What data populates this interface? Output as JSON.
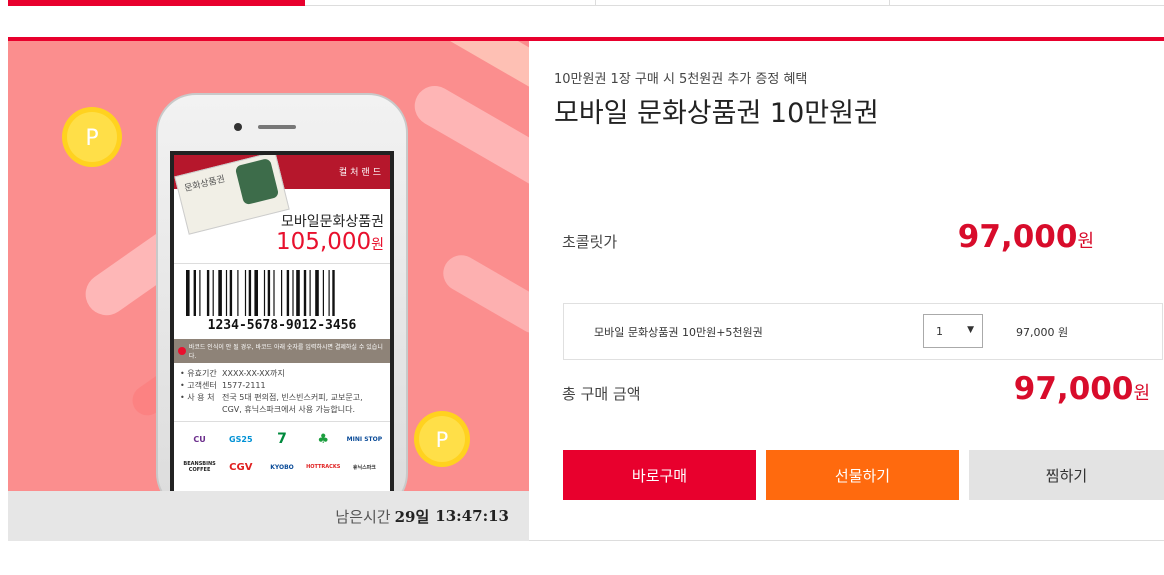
{
  "colors": {
    "accent": "#e8002d",
    "gift": "#ff6a0e",
    "wish": "#e3e3e3",
    "visual_bg": "#fb8e8e",
    "coin": "#ffd21f"
  },
  "tabs": [
    {
      "label": ""
    },
    {
      "label": ""
    },
    {
      "label": ""
    },
    {
      "label": ""
    }
  ],
  "product": {
    "subtitle": "10만원권 1장 구매 시 5천원권 추가 증정 혜택",
    "title": "모바일 문화상품권 10만원권",
    "price_label": "초콜릿가",
    "price": "97,000",
    "currency": "원"
  },
  "visual": {
    "coin_symbol": "P",
    "ticket_brand": "컬처랜드",
    "voucher_text": "문화상품권",
    "ticket_name": "모바일문화상품권",
    "ticket_price": "105,000",
    "ticket_price_unit": "원",
    "barcode_number": "1234-5678-9012-3456",
    "notice": "바코드 인식이 안 될 경우, 바코드 아래 숫자를 입력하시면 결제하실 수 있습니다.",
    "info": [
      {
        "key": "• 유효기간",
        "value": "XXXX-XX-XX까지"
      },
      {
        "key": "• 고객센터",
        "value": "1577-2111"
      },
      {
        "key": "• 사 용 처",
        "value": "전국 5대 편의점, 빈스빈스커피, 교보문고, CGV, 휴닉스파크에서 사용 가능합니다."
      }
    ],
    "logos": [
      "CU",
      "GS25",
      "7",
      "♣",
      "MINI STOP",
      "BEANSBINS COFFEE",
      "CGV",
      "KYOBO",
      "HOTTRACKS",
      "휴닉스파크"
    ]
  },
  "timer": {
    "label": "남은시간",
    "days": "29일",
    "time": "13:47:13"
  },
  "option": {
    "name": "모바일 문화상품권 10만원+5천원권",
    "qty": "1",
    "price": "97,000 원"
  },
  "total": {
    "label": "총 구매 금액",
    "amount": "97,000",
    "currency": "원"
  },
  "buttons": {
    "buy": "바로구매",
    "gift": "선물하기",
    "wish": "찜하기"
  }
}
